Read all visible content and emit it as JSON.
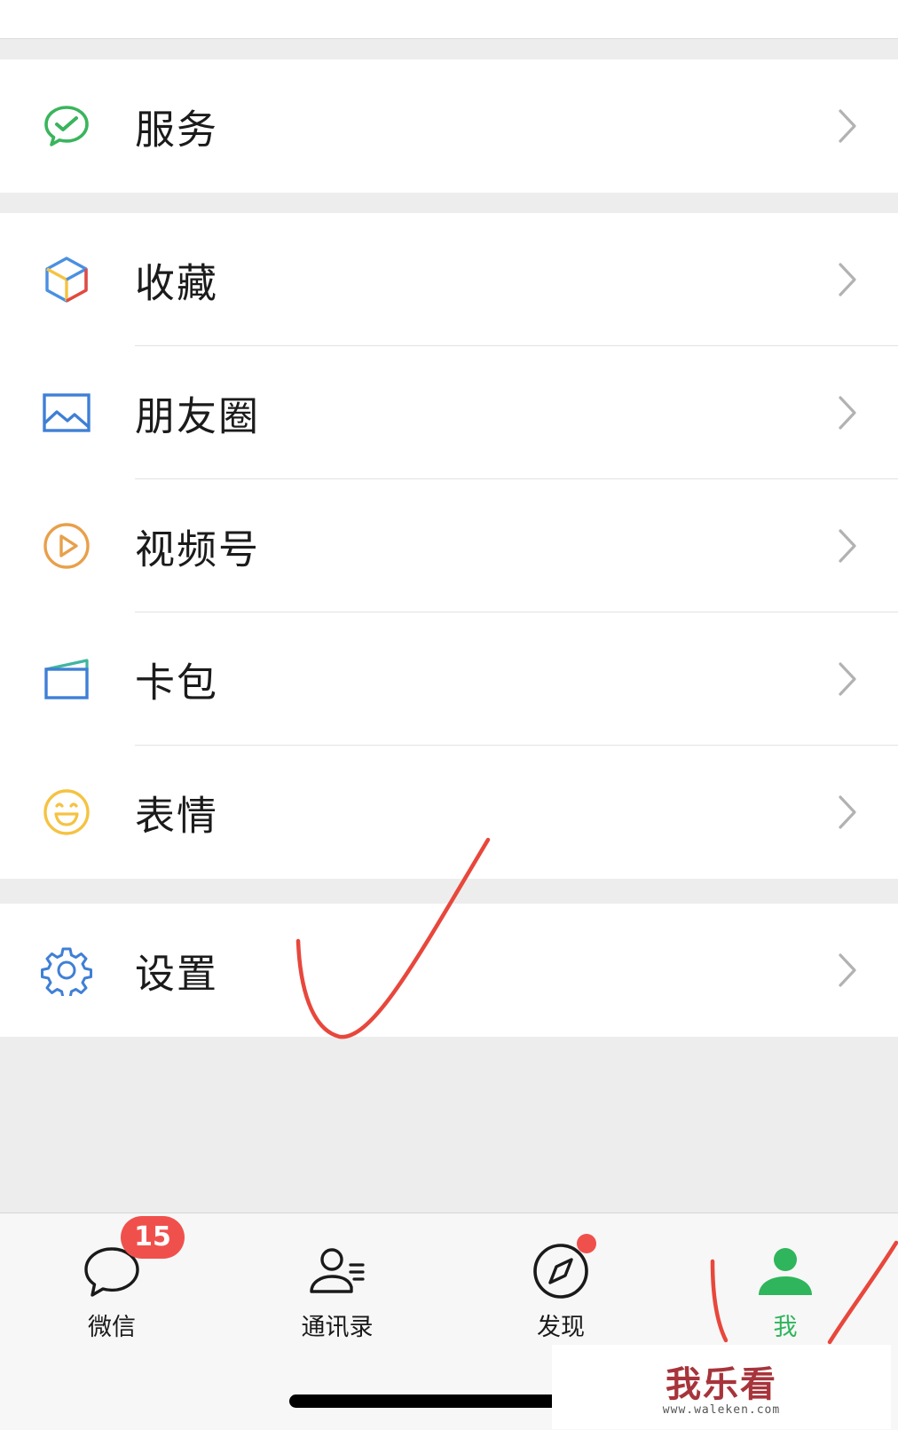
{
  "menu": {
    "service": {
      "label": "服务",
      "icon": "wechat-pay-check-icon"
    },
    "favorites": {
      "label": "收藏",
      "icon": "cube-icon"
    },
    "moments": {
      "label": "朋友圈",
      "icon": "image-icon"
    },
    "channels": {
      "label": "视频号",
      "icon": "play-circle-icon"
    },
    "card_wallet": {
      "label": "卡包",
      "icon": "card-wallet-icon"
    },
    "stickers": {
      "label": "表情",
      "icon": "smiley-icon"
    },
    "settings": {
      "label": "设置",
      "icon": "gear-icon"
    }
  },
  "tabbar": {
    "chats": {
      "label": "微信",
      "badge": "15"
    },
    "contacts": {
      "label": "通讯录"
    },
    "discover": {
      "label": "发现",
      "has_dot": true
    },
    "me": {
      "label": "我",
      "active": true
    }
  },
  "watermark": {
    "title": "我乐看",
    "url": "www.waleken.com"
  },
  "colors": {
    "accent_green": "#2fb55c",
    "badge_red": "#f0504c",
    "annotation_red": "#e8473c",
    "background": "#ededed"
  }
}
